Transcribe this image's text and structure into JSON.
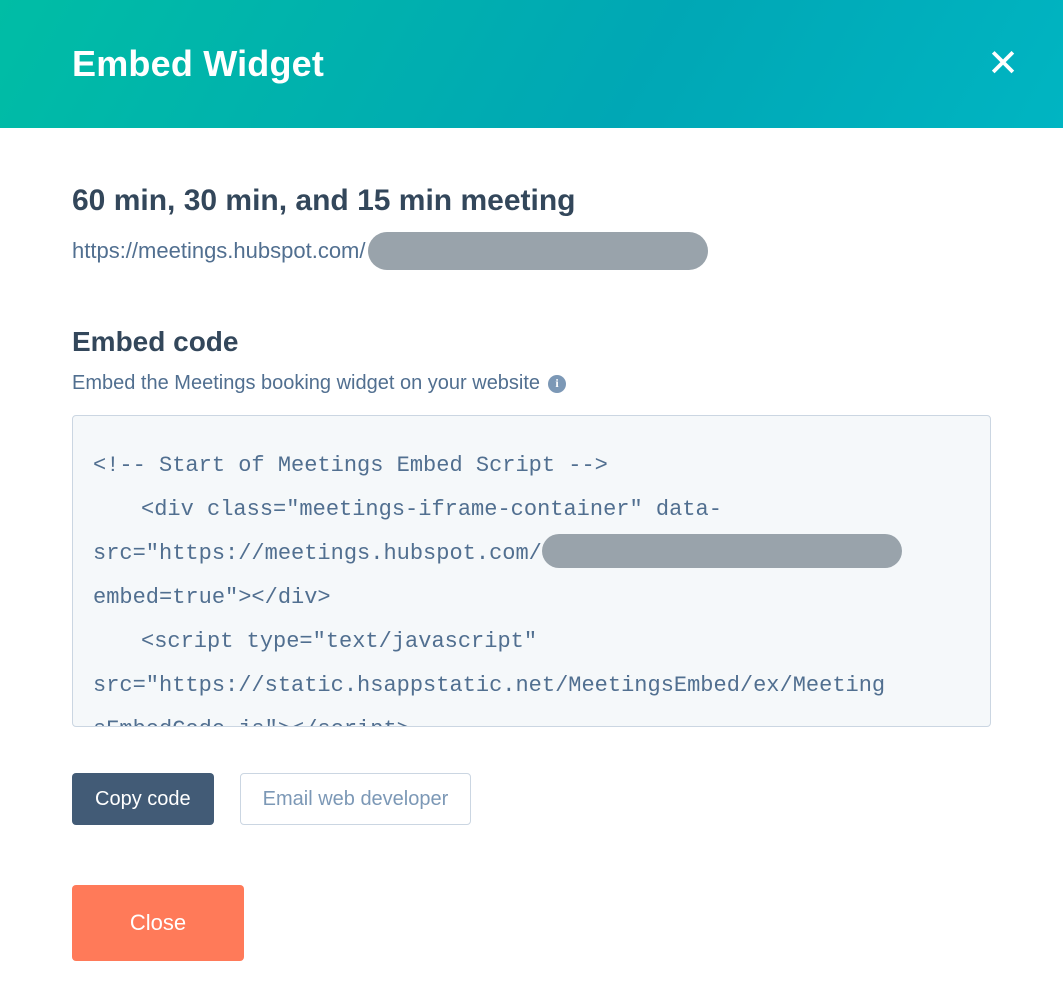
{
  "header": {
    "title": "Embed Widget"
  },
  "meeting": {
    "title": "60 min, 30 min, and 15 min meeting",
    "url_prefix": "https://meetings.hubspot.com/"
  },
  "embed": {
    "heading": "Embed code",
    "subtext": "Embed the Meetings booking widget on your website",
    "code": {
      "l1": "<!-- Start of Meetings Embed Script -->",
      "l2_a": "<div class=\"meetings-iframe-container\" data-",
      "l3_a": "src=\"https://meetings.hubspot.com/",
      "l4": "embed=true\"></div>",
      "l5": "<script type=\"text/javascript\"",
      "l6": "src=\"https://static.hsappstatic.net/MeetingsEmbed/ex/Meeting",
      "l7": "sEmbedCode.js\"></script>"
    }
  },
  "buttons": {
    "copy": "Copy code",
    "email_dev": "Email web developer",
    "close": "Close"
  }
}
